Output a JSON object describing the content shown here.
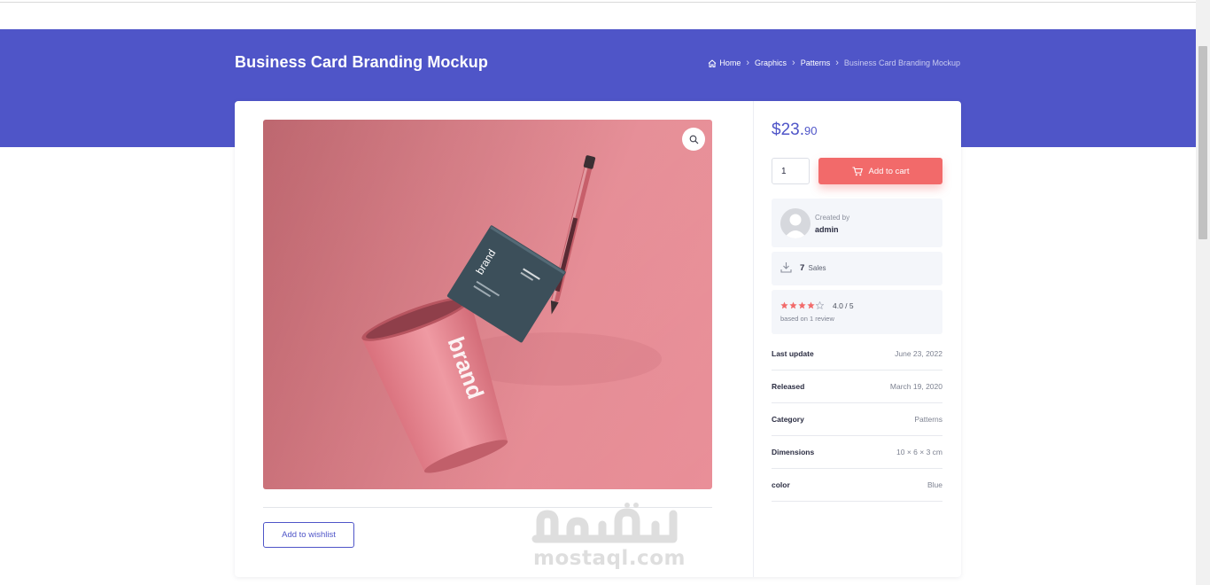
{
  "header": {
    "title": "Business Card Branding Mockup",
    "breadcrumb": [
      {
        "label": "Home",
        "icon": "home-icon"
      },
      {
        "label": "Graphics"
      },
      {
        "label": "Patterns"
      },
      {
        "label": "Business Card Branding Mockup"
      }
    ]
  },
  "colors": {
    "brand": "#4f55c8",
    "cart_button": "#f26a6a",
    "image_background": "#e58a93"
  },
  "product": {
    "image_texts": {
      "cup_print": "brand",
      "card_print": "brand"
    },
    "zoom_icon": "search-icon",
    "wishlist_label": "Add to wishlist"
  },
  "purchase": {
    "price_main": "$23.",
    "price_cents": "90",
    "quantity": "1",
    "add_to_cart_label": "Add to cart"
  },
  "author": {
    "created_label": "Created by",
    "name": "admin"
  },
  "sales": {
    "count": "7",
    "label": "Sales"
  },
  "rating": {
    "value": "4.0 / 5",
    "stars_filled": 4,
    "stars_total": 5,
    "sub": "based on 1 review"
  },
  "meta": [
    {
      "key": "Last update",
      "value": "June 23, 2022"
    },
    {
      "key": "Released",
      "value": "March 19, 2020"
    },
    {
      "key": "Category",
      "value": "Patterns"
    },
    {
      "key": "Dimensions",
      "value": "10 × 6 × 3 cm"
    },
    {
      "key": "color",
      "value": "Blue"
    }
  ],
  "watermark": {
    "arabic": "مستقل",
    "latin": "mostaql.com"
  }
}
